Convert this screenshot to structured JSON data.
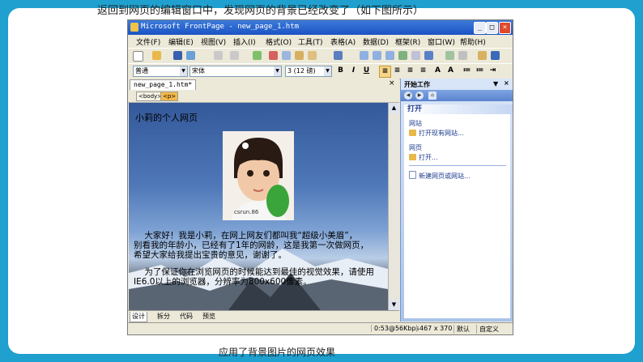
{
  "slide": {
    "caption_top": "返回到网页的编辑窗口中，发现网页的背景已经改变了（如下图所示）",
    "caption_bottom": "应用了背景图片的网页效果"
  },
  "window": {
    "title": "Microsoft FrontPage - new_page_1.htm",
    "menu": [
      "文件(F)",
      "编辑(E)",
      "视图(V)",
      "插入(I)",
      "格式(O)",
      "工具(T)",
      "表格(A)",
      "数据(D)",
      "框架(R)",
      "窗口(W)",
      "帮助(H)"
    ],
    "style_select": "普通",
    "font_select": "宋体",
    "size_select": "3 (12 磅)"
  },
  "editor": {
    "doc_tab": "new_page_1.htm*",
    "tags": [
      "<body>",
      "<p>"
    ],
    "page_title_text": "小莉的个人网页",
    "photo_watermark": "csrun.86",
    "para1": "    大家好！我是小莉，在网上网友们都叫我“超级小美眉”，\n别看我的年龄小，已经有了1年的网龄，这是我第一次做网页，\n希望大家给我提出宝贵的意见，谢谢了。",
    "para2": "    为了保证你在浏览网页的时候能达到最佳的视觉效果，请使用\nIE6.0以上的浏览器，分辨率为800x600像素。",
    "view_tabs": [
      "设计",
      "拆分",
      "代码",
      "预览"
    ]
  },
  "statusbar": {
    "speed": "0:53@56Kbps",
    "size": "467 x 370",
    "mode": "默认",
    "custom": "自定义"
  },
  "taskpane": {
    "title": "开始工作",
    "section": "打开",
    "group1": "网站",
    "link1": "打开现有网站...",
    "group2": "网页",
    "link2": "打开...",
    "link3": "新建网页或网站..."
  },
  "colors": {
    "slide_bg": "#1fa0cf",
    "titlebar": "#1a53c4",
    "taskpane_bg": "#aac3ea"
  }
}
